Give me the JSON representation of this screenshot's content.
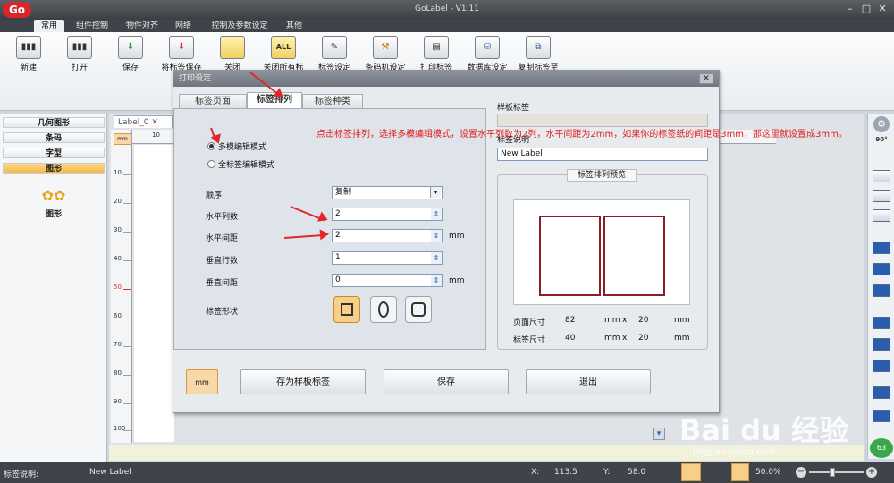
{
  "app": {
    "logo": "Go",
    "title": "GoLabel - V1.11"
  },
  "window_controls": [
    "–",
    "□",
    "✕"
  ],
  "menu_tabs": [
    "常用",
    "组件控制",
    "物件对齐",
    "网络",
    "控制及参数设定",
    "其他"
  ],
  "ribbon": [
    {
      "label": "新建",
      "icon": "barcode-new-icon",
      "glyph": "▮▮▮"
    },
    {
      "label": "打开",
      "icon": "barcode-open-icon",
      "glyph": "▮▮▮"
    },
    {
      "label": "保存",
      "icon": "save-icon",
      "glyph": "⬇"
    },
    {
      "label": "将标签保存",
      "icon": "save-as-icon",
      "glyph": "⬇"
    },
    {
      "label": "关闭",
      "icon": "folder-close-icon",
      "glyph": ""
    },
    {
      "label": "关闭所有标",
      "icon": "close-all-icon",
      "glyph": "ALL"
    },
    {
      "label": "标签设定",
      "icon": "label-settings-icon",
      "glyph": "✎"
    },
    {
      "label": "条码机设定",
      "icon": "printer-settings-icon",
      "glyph": "⚒"
    },
    {
      "label": "打印标签",
      "icon": "print-label-icon",
      "glyph": "▤"
    },
    {
      "label": "数据库设定",
      "icon": "database-settings-icon",
      "glyph": "⛁"
    },
    {
      "label": "复制标签至",
      "icon": "copy-label-icon",
      "glyph": "⧉"
    }
  ],
  "left_panel": {
    "items": [
      "几何图形",
      "条码",
      "字型",
      "图形"
    ],
    "selected": "图形",
    "tool_label": "图形"
  },
  "document_tab": "Label_0",
  "ruler": {
    "unit": "mm",
    "h_tick": "10",
    "v_ticks": [
      "10",
      "20",
      "30",
      "40",
      "50",
      "60",
      "70",
      "80",
      "90",
      "100"
    ]
  },
  "dialog": {
    "title": "打印设定",
    "close": "✕",
    "tabs": [
      "标签页面",
      "标签排列",
      "标签种类"
    ],
    "active_tab": "标签排列",
    "mode_options": [
      "多模编辑模式",
      "全标签编辑模式"
    ],
    "selected_mode": "多模编辑模式",
    "fields": {
      "order": {
        "label": "顺序",
        "value": "复制"
      },
      "h_cols": {
        "label": "水平列数",
        "value": "2"
      },
      "h_gap": {
        "label": "水平间距",
        "value": "2",
        "unit": "mm"
      },
      "v_rows": {
        "label": "垂直行数",
        "value": "1"
      },
      "v_gap": {
        "label": "垂直间距",
        "value": "0",
        "unit": "mm"
      },
      "shape": {
        "label": "标签形状",
        "options": [
          "rect-shape-icon",
          "oval-shape-icon",
          "rounded-shape-icon"
        ],
        "selected": "rect-shape-icon"
      }
    },
    "template": {
      "label": "样板标签",
      "desc_label": "标签说明",
      "desc_value": "New Label"
    },
    "preview": {
      "title": "标签排列预览",
      "page_size_label": "页面尺寸",
      "page_w": "82",
      "page_h": "20",
      "label_size_label": "标签尺寸",
      "label_w": "40",
      "label_h": "20",
      "unit": "mm",
      "x": "x"
    },
    "buttons": {
      "unit": "mm",
      "save_template": "存为样板标签",
      "save": "保存",
      "exit": "退出"
    }
  },
  "annotation": "点击标签排列，选择多模编辑模式，设置水平列数为2列，水平间距为2mm，如果你的标签纸的间距是3mm，那这里就设置成3mm。",
  "statusbar": {
    "desc_label": "标签说明:",
    "desc_value": "New Label",
    "x_label": "X:",
    "x_value": "113.5",
    "y_label": "Y:",
    "y_value": "58.0",
    "zoom": "50.0%",
    "minus": "−",
    "plus": "+"
  },
  "watermark": {
    "main": "Bai du 经验",
    "sub": "jingyan.baidu.com"
  },
  "colors": {
    "accent": "#f6b94a",
    "annotation": "#e02020",
    "preview_border": "#8e1c28",
    "titlebar": "#3b3f44"
  }
}
